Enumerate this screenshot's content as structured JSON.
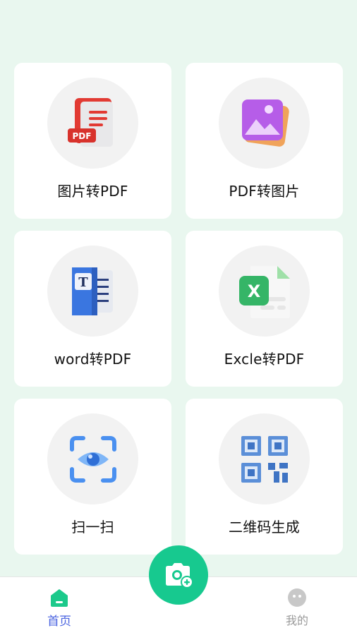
{
  "colors": {
    "background": "#e9f7ef",
    "accent": "#17c98f",
    "nav_active": "#4a63e0",
    "nav_inactive": "#9a9a9a"
  },
  "tools": [
    {
      "label": "图片转PDF",
      "icon": "image-to-pdf-icon"
    },
    {
      "label": "PDF转图片",
      "icon": "pdf-to-image-icon"
    },
    {
      "label": "word转PDF",
      "icon": "word-to-pdf-icon"
    },
    {
      "label": "Excle转PDF",
      "icon": "excel-to-pdf-icon"
    },
    {
      "label": "扫一扫",
      "icon": "scan-eye-icon"
    },
    {
      "label": "二维码生成",
      "icon": "qr-code-icon"
    }
  ],
  "pdf_badge": "PDF",
  "word_badge": "T",
  "excel_badge": "X",
  "fab": {
    "icon": "camera-add-icon"
  },
  "nav": {
    "home": {
      "label": "首页",
      "icon": "home-icon"
    },
    "mine": {
      "label": "我的",
      "icon": "smiley-face-icon"
    }
  }
}
